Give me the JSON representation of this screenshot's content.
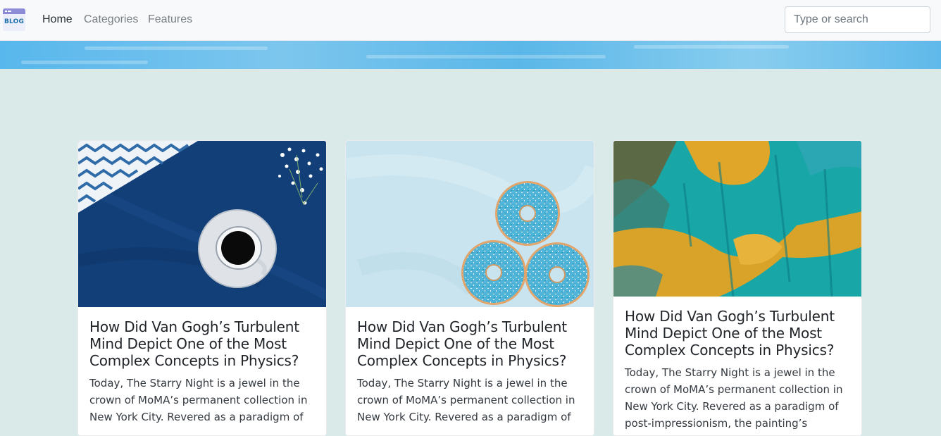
{
  "brand": {
    "logo_text": "BLOG"
  },
  "nav": {
    "items": [
      {
        "label": "Home",
        "active": true
      },
      {
        "label": "Categories",
        "active": false
      },
      {
        "label": "Features",
        "active": false
      }
    ],
    "search_placeholder": "Type or search"
  },
  "posts": [
    {
      "image": "coffee-cup-on-blue-cloth",
      "title": "How Did Van Gogh’s Turbulent Mind Depict One of the Most Complex Concepts in Physics?",
      "excerpt": "Today, The Starry Night is a jewel in the crown of MoMA’s permanent collection in New York City. Revered as a paradigm of"
    },
    {
      "image": "blue-sprinkled-donuts",
      "title": "How Did Van Gogh’s Turbulent Mind Depict One of the Most Complex Concepts in Physics?",
      "excerpt": "Today, The Starry Night is a jewel in the crown of MoMA’s permanent collection in New York City. Revered as a paradigm of"
    },
    {
      "image": "teal-yellow-abstract-paint",
      "title": "How Did Van Gogh’s Turbulent Mind Depict One of the Most Complex Concepts in Physics?",
      "excerpt": "Today, The Starry Night is a jewel in the crown of MoMA’s permanent collection in New York City. Revered as a paradigm of post-impressionism, the painting’s tranquil"
    }
  ],
  "colors": {
    "page_background": "#d9eae9",
    "navbar_background": "#f8f9fa",
    "hero_blue": "#5ab7e8"
  }
}
